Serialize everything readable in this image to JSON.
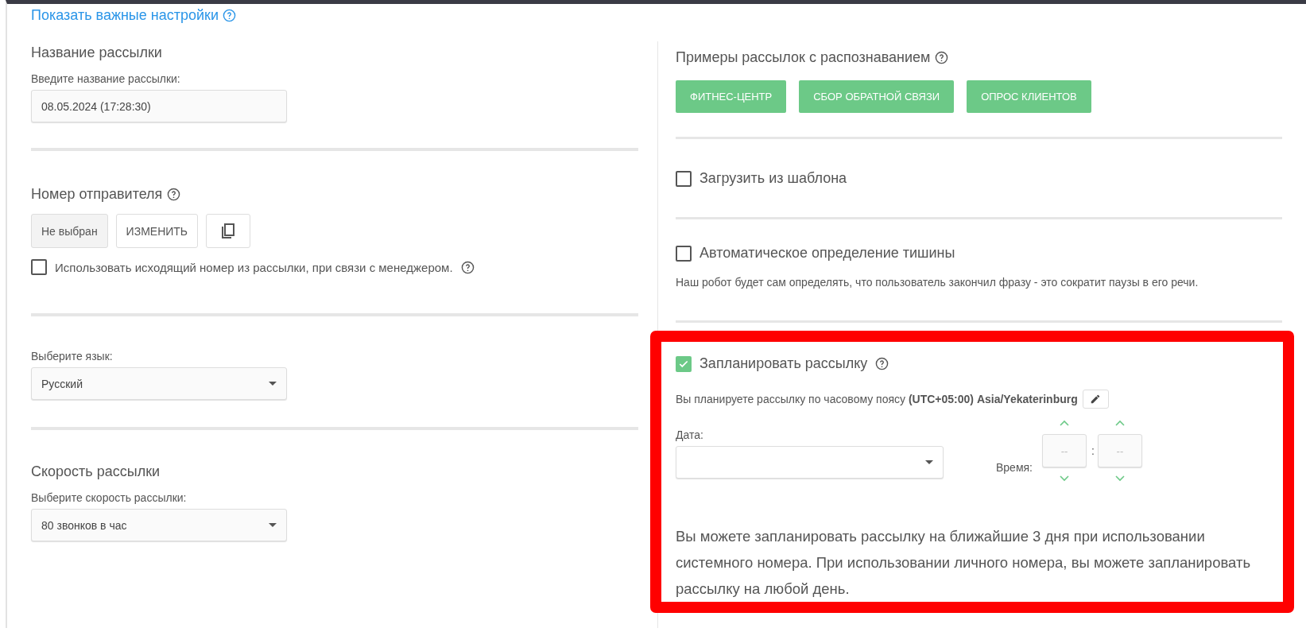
{
  "important_settings_link": "Показать важные настройки",
  "left": {
    "name_section": {
      "title": "Название рассылки",
      "field_label": "Введите название рассылки:",
      "value": "08.05.2024 (17:28:30)"
    },
    "sender_section": {
      "title": "Номер отправителя",
      "current_number": "Не выбран",
      "change_button": "ИЗМЕНИТЬ",
      "use_outgoing": {
        "label": "Использовать исходящий номер из рассылки, при связи с менеджером.",
        "checked": false
      }
    },
    "language_section": {
      "field_label": "Выберите язык:",
      "value": "Русский"
    },
    "speed_section": {
      "title": "Скорость рассылки",
      "field_label": "Выберите скорость рассылки:",
      "value": "80 звонков в час"
    }
  },
  "right": {
    "examples": {
      "title": "Примеры рассылок с распознаванием",
      "buttons": [
        "ФИТНЕС-ЦЕНТР",
        "СБОР ОБРАТНОЙ СВЯЗИ",
        "ОПРОС КЛИЕНТОВ"
      ]
    },
    "options": [
      {
        "label": "Загрузить из шаблона",
        "checked": false
      },
      {
        "label": "Автоматическое определение тишины",
        "checked": false,
        "description": "Наш робот будет сам определять, что пользователь закончил фразу - это сократит паузы в его речи."
      }
    ],
    "schedule": {
      "label": "Запланировать рассылку",
      "checked": true,
      "highlighted": true,
      "timezone_text": "Вы планируете рассылку по часовому поясу **(UTC+05:00) Asia/Yekaterinburg**",
      "date_label": "Дата:",
      "time_label": "Время:",
      "hours_placeholder": "--",
      "separator": ":",
      "minutes_placeholder": "--",
      "note": "Вы можете запланировать рассылку на ближайшие 3 дня при использовании системного номера. При использовании личного номера, вы можете запланировать рассылку на любой день."
    }
  }
}
